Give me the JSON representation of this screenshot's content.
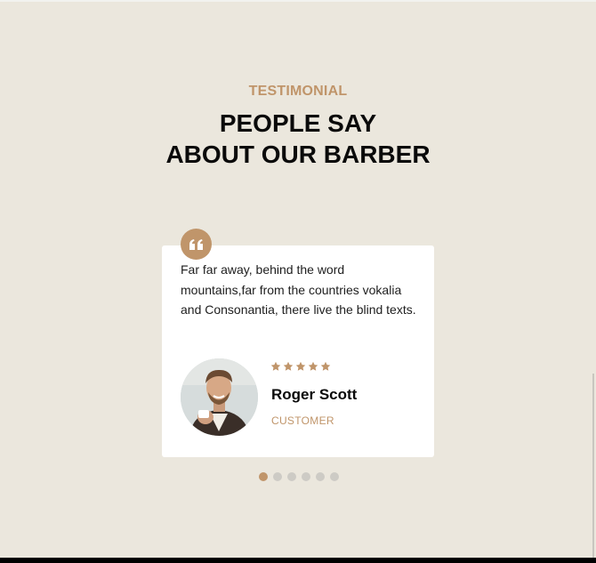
{
  "section": {
    "eyebrow": "TESTIMONIAL",
    "title_line1": "PEOPLE SAY",
    "title_line2": "ABOUT OUR BARBER"
  },
  "testimonial": {
    "quote": "Far far away, behind the word mountains,far from the countries vokalia and Consonantia, there live the blind texts.",
    "rating": 5,
    "author_name": "Roger Scott",
    "author_role": "CUSTOMER",
    "avatar_icon": "person-portrait-icon",
    "quote_icon": "quote-icon"
  },
  "carousel": {
    "slide_count": 6,
    "active_index": 0
  },
  "colors": {
    "accent": "#c0956a",
    "background": "#ebe7dd",
    "card": "#ffffff",
    "dot_inactive": "#cdcbc5"
  }
}
